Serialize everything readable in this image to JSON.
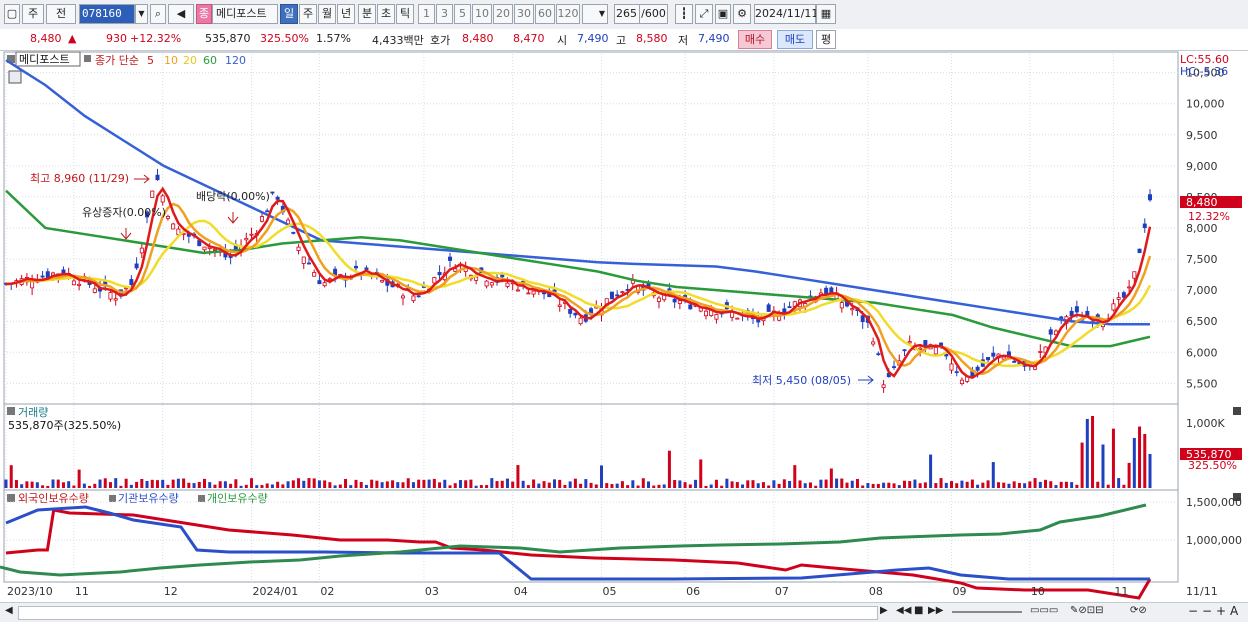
{
  "toolbar": {
    "mode1": "주",
    "mode2": "전",
    "code": "078160",
    "stock_name": "메디포스트",
    "badge": "종",
    "periods": [
      "일",
      "주",
      "월",
      "년",
      "분",
      "초",
      "틱"
    ],
    "intervals": [
      "1",
      "3",
      "5",
      "10",
      "20",
      "30",
      "60",
      "120"
    ],
    "count": "265",
    "count_max": "/600",
    "date": "2024/11/11"
  },
  "quote": {
    "price": "8,480",
    "change": "930",
    "change_pct": "+12.32%",
    "volume": "535,870",
    "volume_pct": "325.50%",
    "turnover_pct": "1.57%",
    "amount": "4,433백만",
    "bid_label": "호가",
    "ask": "8,480",
    "bid": "8,470",
    "open_label": "시",
    "open": "7,490",
    "high_label": "고",
    "high": "8,580",
    "low_label": "저",
    "low": "7,490",
    "buy_label": "매수",
    "sell_label": "매도",
    "avg_label": "평"
  },
  "price_panel": {
    "name": "메디포스트",
    "ma_title": "종가 단순",
    "ma_periods": [
      "5",
      "10",
      "20",
      "60",
      "120"
    ],
    "lc": "LC:55.60",
    "hc": "HC:-5.36",
    "max_label": "최고 8,960 (11/29)",
    "min_label": "최저 5,450 (08/05)",
    "event1": "유상증자(0.00%)",
    "event2": "배당락(0.00%)",
    "price_tag": "8,480",
    "pct_tag": "12.32%"
  },
  "volume_panel": {
    "title": "거래량",
    "value": "535,870주(325.50%)",
    "tag": "535,870",
    "tag_pct": "325.50%"
  },
  "holding_panel": {
    "legend": [
      "외국인보유수량",
      "기관보유수량",
      "개인보유수량"
    ]
  },
  "colors": {
    "up": "#d0021b",
    "down": "#1f3fbf",
    "ma5": "#e01a1a",
    "ma10": "#f0a020",
    "ma20": "#f2dc2a",
    "ma60": "#2a9a3a",
    "ma120": "#3560d8"
  },
  "chart_data": [
    {
      "type": "line",
      "title": "메디포스트",
      "x": [
        "2023/10",
        "11",
        "12",
        "2024/01",
        "02",
        "03",
        "04",
        "05",
        "06",
        "07",
        "08",
        "09",
        "10",
        "11",
        "11/11"
      ],
      "yticks": [
        5500,
        6000,
        6500,
        7000,
        7500,
        8000,
        8500,
        9000,
        9500,
        10000,
        10500
      ],
      "ylim": [
        5200,
        10800
      ],
      "series": [
        {
          "name": "120",
          "values": [
            10700,
            10300,
            9800,
            9400,
            9000,
            8700,
            8400,
            8100,
            7800,
            7750,
            7700,
            7650,
            7600,
            7550,
            7500,
            7450,
            7420,
            7400,
            7380,
            7300,
            7200,
            7100,
            7000,
            6900,
            6800,
            6700,
            6600,
            6500,
            6450,
            6450
          ]
        },
        {
          "name": "60",
          "values": [
            8600,
            8000,
            7900,
            7800,
            7700,
            7600,
            7650,
            7750,
            7800,
            7850,
            7800,
            7700,
            7600,
            7500,
            7400,
            7300,
            7150,
            7050,
            7000,
            6950,
            6900,
            6850,
            6800,
            6700,
            6600,
            6400,
            6250,
            6100,
            6100,
            6250
          ]
        }
      ]
    },
    {
      "type": "bar",
      "title": "거래량",
      "yticks": [
        "1,000K"
      ],
      "last_value": 535870
    },
    {
      "type": "line",
      "title": "보유수량",
      "yticks": [
        1000000,
        1500000
      ],
      "series": [
        {
          "name": "외국인보유수량"
        },
        {
          "name": "기관보유수량"
        },
        {
          "name": "개인보유수량"
        }
      ]
    }
  ]
}
